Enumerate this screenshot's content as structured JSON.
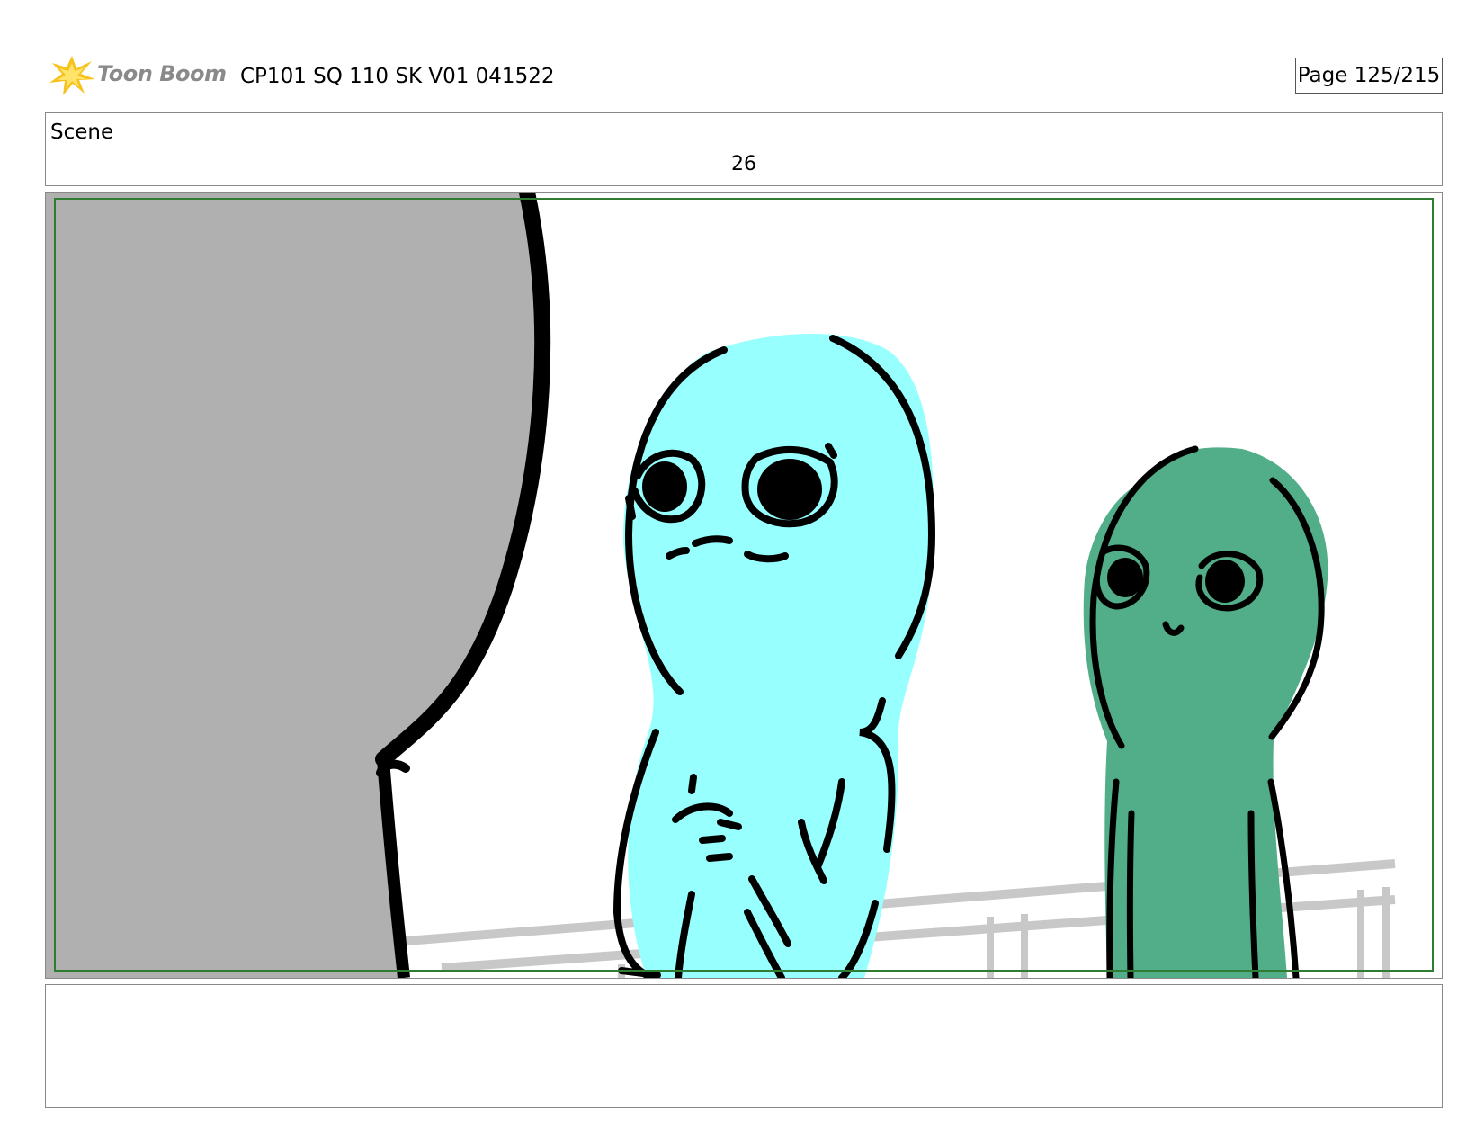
{
  "header": {
    "logo_text": "Toon Boom",
    "document_title": "CP101 SQ 110 SK V01 041522",
    "page_indicator": "Page 125/215"
  },
  "scene": {
    "label": "Scene",
    "number": "26"
  },
  "panel": {
    "image_name": "storyboard-frame",
    "colors": {
      "curtain": "#b0b0b0",
      "blue_character": "#97fffd",
      "green_character": "#52ad89",
      "railing": "#c8c8c8",
      "safe_frame": "#2f7d32"
    }
  },
  "notes": {
    "text": ""
  }
}
